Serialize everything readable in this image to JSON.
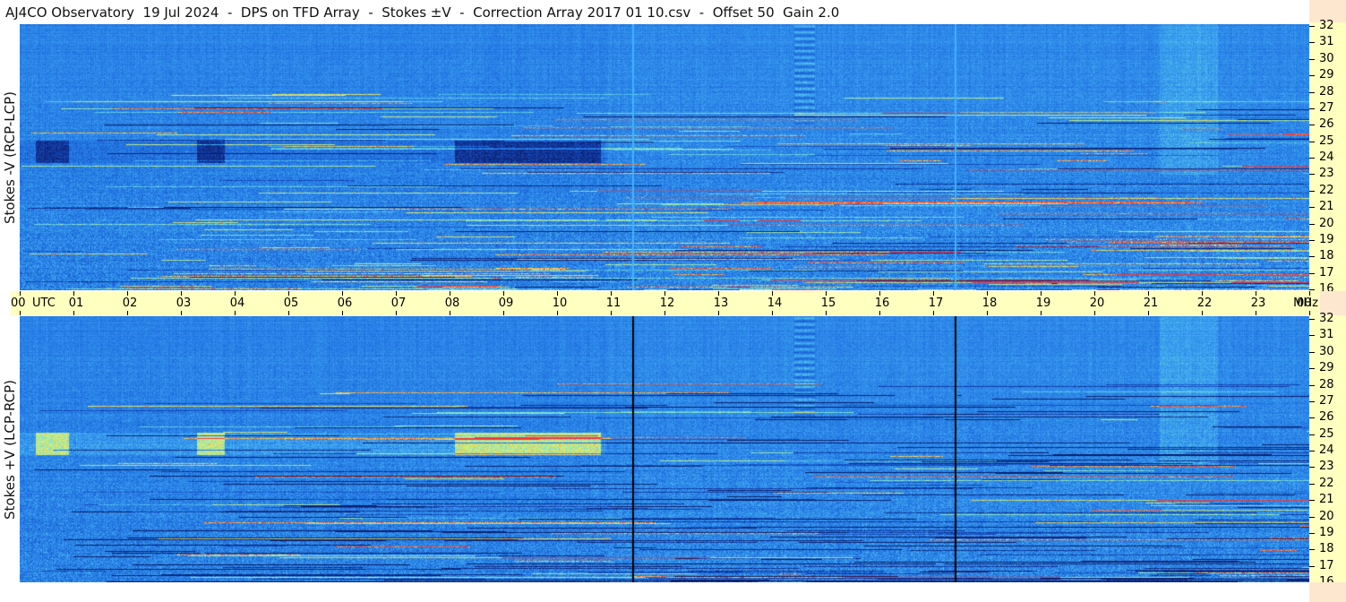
{
  "header": {
    "title": "AJ4CO Observatory  19 Jul 2024  -  DPS on TFD Array  -  Stokes ±V  -  Correction Array 2017 01 10.csv  -  Offset 50  Gain 2.0"
  },
  "panels": {
    "top_ylabel": "Stokes -V (RCP-LCP)",
    "bottom_ylabel": "Stokes +V (LCP-RCP)"
  },
  "time_axis": {
    "labels": [
      "00",
      "01",
      "02",
      "03",
      "04",
      "05",
      "06",
      "07",
      "08",
      "09",
      "10",
      "11",
      "12",
      "13",
      "14",
      "15",
      "16",
      "17",
      "18",
      "19",
      "20",
      "21",
      "22",
      "23",
      "00"
    ],
    "utc_label": "UTC",
    "mhz_label": "MHz"
  },
  "freq_axis": {
    "labels": [
      "32",
      "31",
      "30",
      "29",
      "28",
      "27",
      "26",
      "25",
      "24",
      "23",
      "22",
      "21",
      "20",
      "19",
      "18",
      "17",
      "16"
    ]
  },
  "chart_data": [
    {
      "type": "heatmap",
      "title": "Stokes -V (RCP-LCP)",
      "x_label": "UTC",
      "y_label": "MHz",
      "x_range": [
        0,
        24
      ],
      "y_range": [
        16,
        32
      ],
      "x_ticks": [
        "00",
        "01",
        "02",
        "03",
        "04",
        "05",
        "06",
        "07",
        "08",
        "09",
        "10",
        "11",
        "12",
        "13",
        "14",
        "15",
        "16",
        "17",
        "18",
        "19",
        "20",
        "21",
        "22",
        "23",
        "00"
      ],
      "y_ticks": [
        32,
        31,
        30,
        29,
        28,
        27,
        26,
        25,
        24,
        23,
        22,
        21,
        20,
        19,
        18,
        17,
        16
      ],
      "colormap": [
        "#0b1f6b",
        "#1546b8",
        "#1f6fe0",
        "#3aa0f0",
        "#6fe0e0",
        "#e8f060",
        "#f03a3a"
      ],
      "features": {
        "dark_band_freq_mhz": [
          23.7,
          25.0
        ],
        "dark_band_time_utc": [
          [
            0.3,
            0.9
          ],
          [
            3.3,
            3.8
          ],
          [
            8.1,
            10.8
          ]
        ],
        "gap_lines_utc": [
          11.4,
          17.4
        ],
        "gap_line_color": "#3fb3ff"
      }
    },
    {
      "type": "heatmap",
      "title": "Stokes +V (LCP-RCP)",
      "x_label": "UTC",
      "y_label": "MHz",
      "x_range": [
        0,
        24
      ],
      "y_range": [
        16,
        32
      ],
      "x_ticks": [
        "00",
        "01",
        "02",
        "03",
        "04",
        "05",
        "06",
        "07",
        "08",
        "09",
        "10",
        "11",
        "12",
        "13",
        "14",
        "15",
        "16",
        "17",
        "18",
        "19",
        "20",
        "21",
        "22",
        "23",
        "00"
      ],
      "y_ticks": [
        32,
        31,
        30,
        29,
        28,
        27,
        26,
        25,
        24,
        23,
        22,
        21,
        20,
        19,
        18,
        17,
        16
      ],
      "colormap": [
        "#0b1f6b",
        "#1546b8",
        "#1f6fe0",
        "#3aa0f0",
        "#6fe0e0",
        "#e8f060",
        "#f03a3a"
      ],
      "features": {
        "bright_band_freq_mhz": [
          23.7,
          25.0
        ],
        "bright_band_time_utc": [
          [
            0.3,
            0.9
          ],
          [
            3.3,
            3.8
          ],
          [
            8.1,
            10.8
          ]
        ],
        "gap_lines_utc": [
          11.4,
          17.4
        ],
        "gap_line_color": "#000000"
      }
    }
  ]
}
